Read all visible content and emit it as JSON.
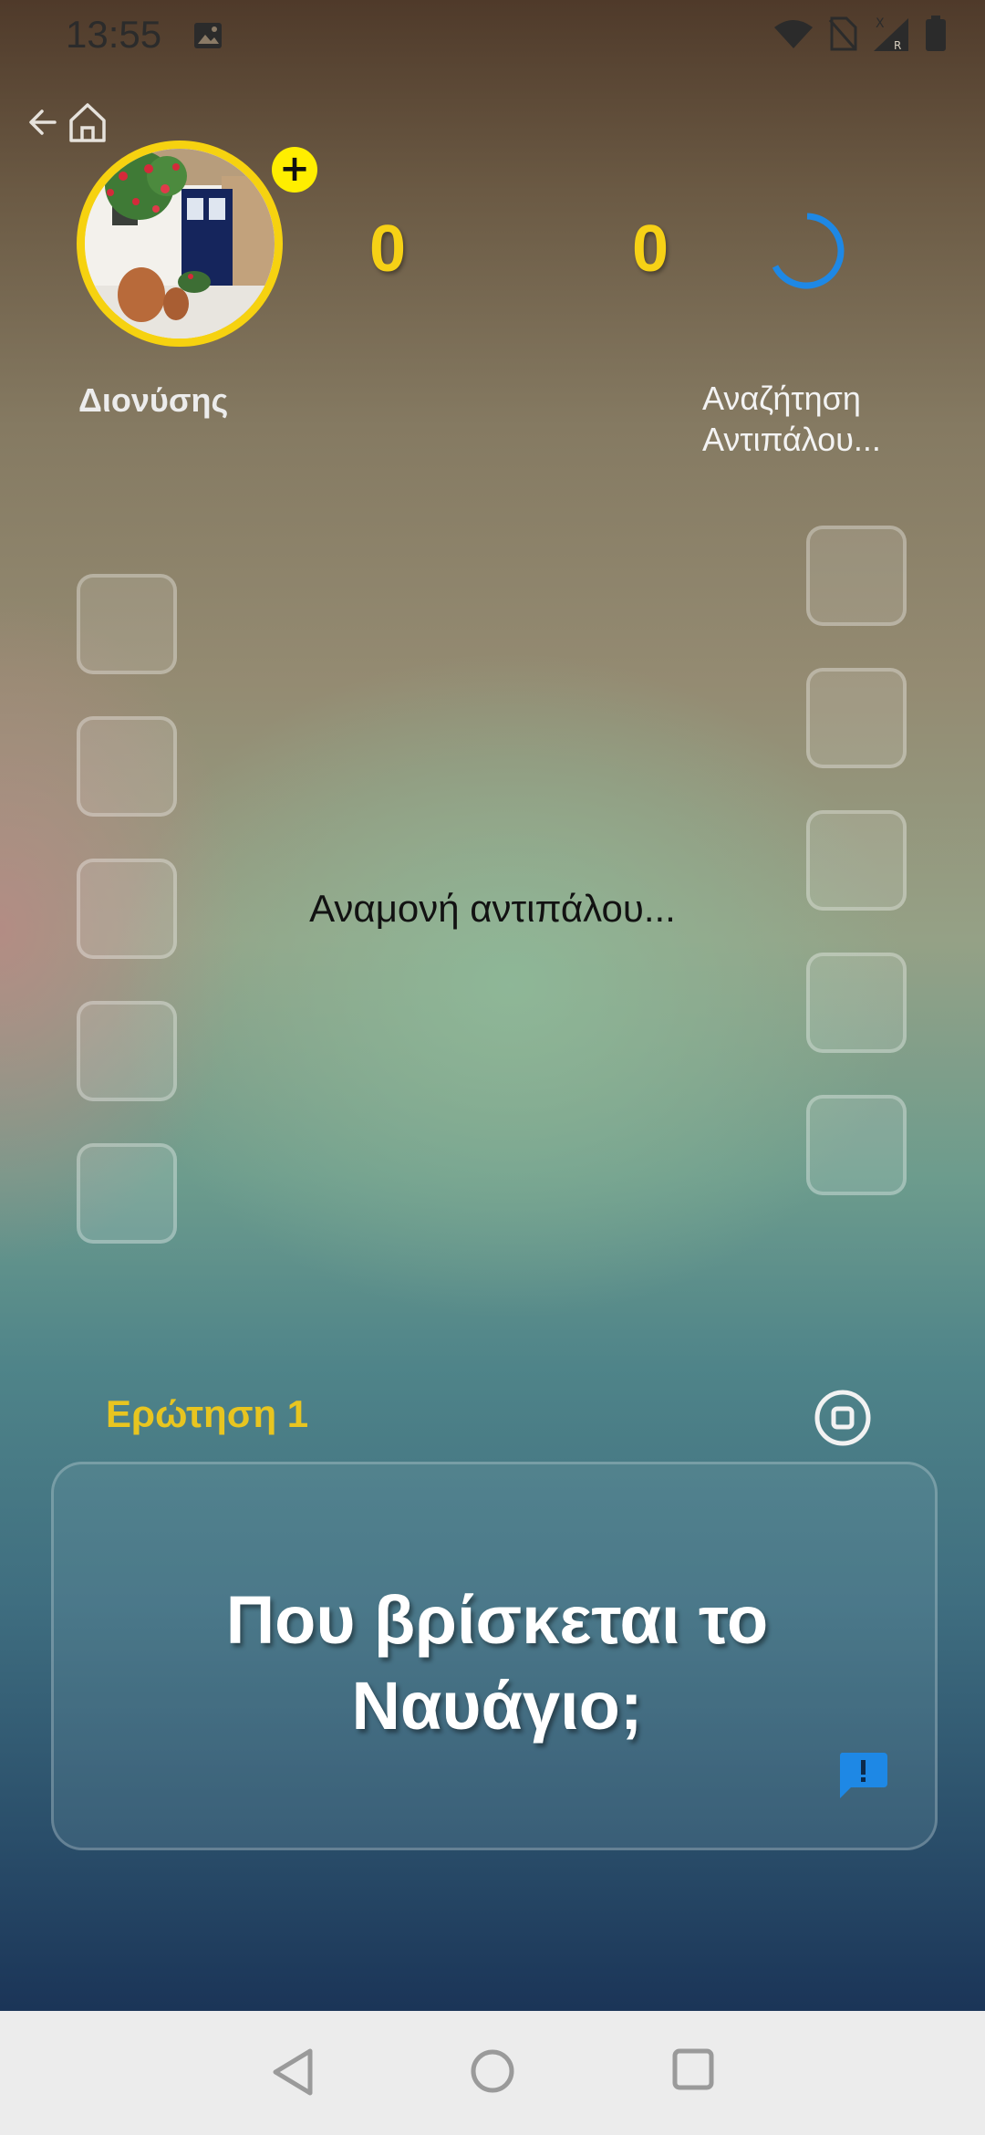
{
  "status_bar": {
    "time": "13:55",
    "icons": [
      "gallery-icon",
      "wifi-icon",
      "no-sim-icon",
      "signal-roaming-icon",
      "battery-icon"
    ]
  },
  "nav": {
    "back_icon": "arrow-left-icon",
    "home_icon": "home-icon"
  },
  "player": {
    "name": "Διονύσης",
    "score": "0",
    "add_badge": "+"
  },
  "opponent": {
    "name_line1": "Αναζήτηση",
    "name_line2": "Αντιπάλου...",
    "score": "0"
  },
  "waiting_text": "Αναμονή αντιπάλου...",
  "question": {
    "label": "Ερώτηση 1",
    "text": "Που βρίσκεται το Ναυάγιο;"
  },
  "colors": {
    "score": "#f6d116",
    "accent_blue": "#1e88e5",
    "label": "#e8c520"
  },
  "system_nav": {
    "back": "triangle-back-icon",
    "home": "circle-home-icon",
    "recents": "square-recents-icon"
  }
}
